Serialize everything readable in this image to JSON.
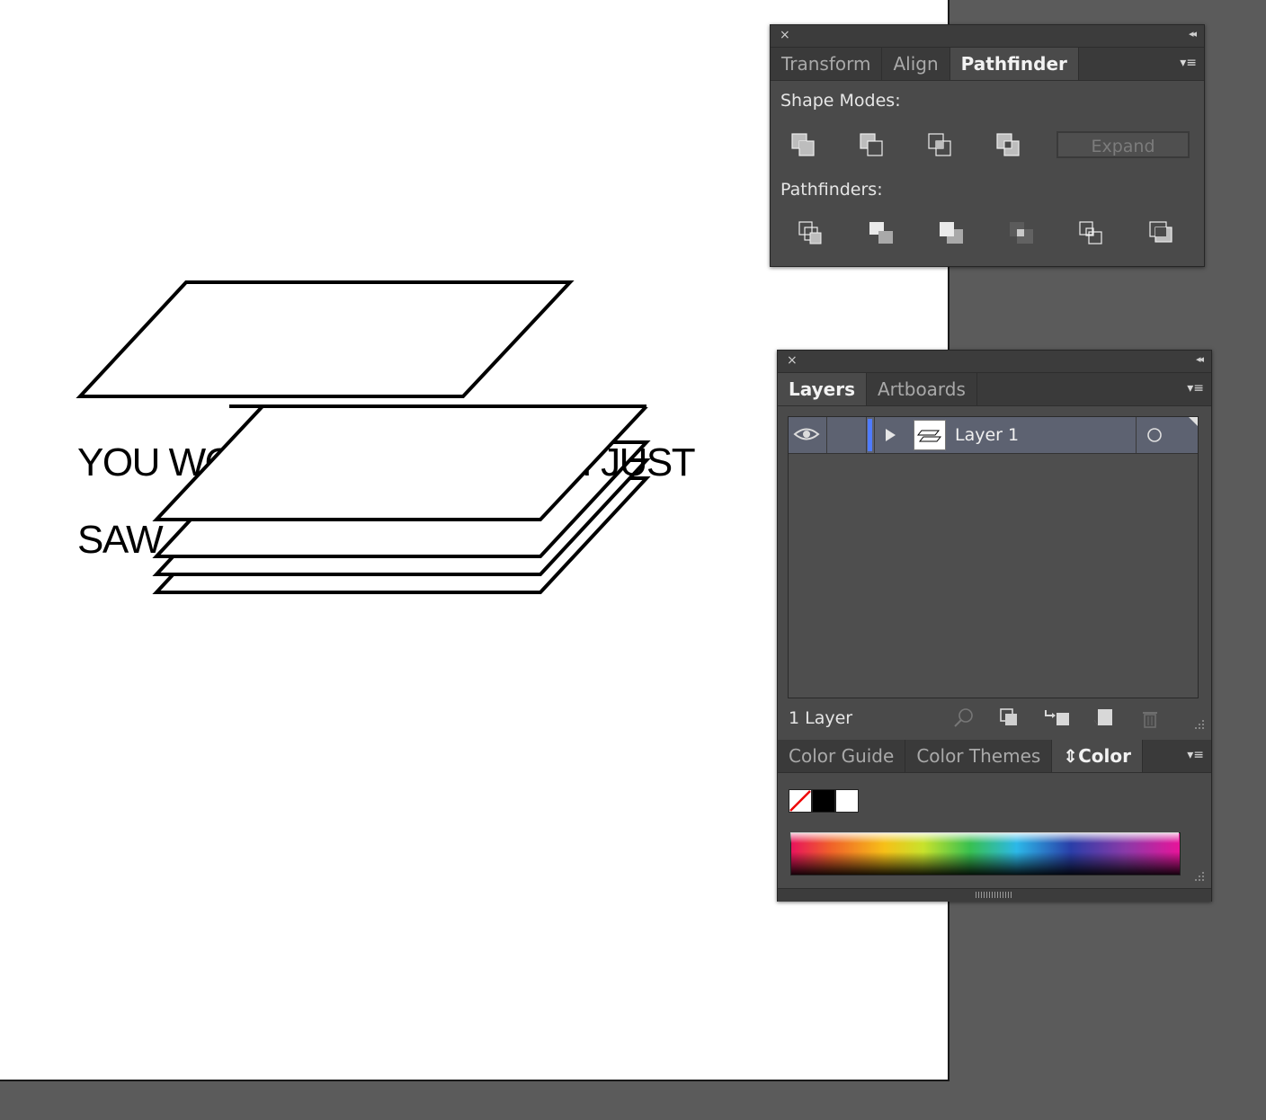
{
  "artboard": {
    "headline_line1": "YOU WON'T BELIEVE WHAT I JUST",
    "headline_line2": "SAW"
  },
  "pathfinder_panel": {
    "close_icon": "×",
    "collapse_icon": "◂◂",
    "tabs": [
      {
        "label": "Transform",
        "active": false
      },
      {
        "label": "Align",
        "active": false
      },
      {
        "label": "Pathfinder",
        "active": true
      }
    ],
    "menu_icon": "▾≡",
    "shape_modes_label": "Shape Modes:",
    "shape_mode_icons": [
      "unite-icon",
      "minus-front-icon",
      "intersect-icon",
      "exclude-icon"
    ],
    "expand_label": "Expand",
    "pathfinders_label": "Pathfinders:",
    "pathfinder_icons": [
      "divide-icon",
      "trim-icon",
      "merge-icon",
      "crop-icon",
      "outline-icon",
      "minus-back-icon"
    ]
  },
  "layers_panel": {
    "close_icon": "×",
    "collapse_icon": "◂◂",
    "tabs": [
      {
        "label": "Layers",
        "active": true
      },
      {
        "label": "Artboards",
        "active": false
      }
    ],
    "menu_icon": "▾≡",
    "layer": {
      "name": "Layer 1",
      "visible": true,
      "color": "#4f7bff"
    },
    "footer_count": "1 Layer",
    "footer_icons": [
      "locate-object-icon",
      "make-clipping-mask-icon",
      "create-sublayer-icon",
      "new-layer-icon",
      "delete-icon"
    ]
  },
  "color_panel": {
    "tabs": [
      {
        "label": "Color Guide",
        "active": false
      },
      {
        "label": "Color Themes",
        "active": false
      },
      {
        "label": "Color",
        "active": true
      }
    ],
    "active_prefix": "⇕",
    "menu_icon": "▾≡"
  }
}
